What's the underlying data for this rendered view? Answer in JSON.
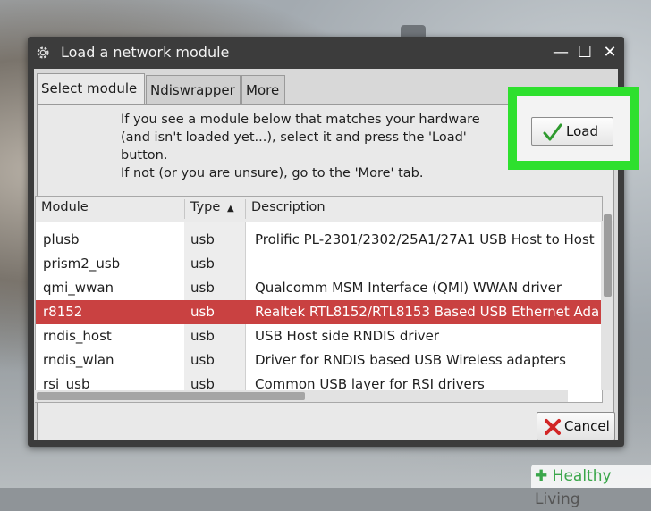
{
  "window": {
    "title": "Load a network module",
    "controls": {
      "minimize": "—",
      "maximize": "☐",
      "close": "✕"
    }
  },
  "tabs": [
    {
      "label": "Select module",
      "active": true
    },
    {
      "label": "Ndiswrapper",
      "active": false
    },
    {
      "label": "More",
      "active": false
    }
  ],
  "info": {
    "line1": "If you see a module below that matches your hardware",
    "line2": "(and isn't loaded yet...), select it and press the 'Load'",
    "line3": "button.",
    "line4": "If not (or you are unsure), go to the 'More' tab."
  },
  "load_button": {
    "label": "Load",
    "icon": "checkmark-icon"
  },
  "table": {
    "columns": {
      "module": "Module",
      "type": "Type",
      "type_sort": "▲",
      "description": "Description"
    },
    "rows": [
      {
        "module": "plusb",
        "type": "usb",
        "description": "Prolific PL-2301/2302/25A1/27A1 USB Host to Host",
        "selected": false
      },
      {
        "module": "prism2_usb",
        "type": "usb",
        "description": "",
        "selected": false
      },
      {
        "module": "qmi_wwan",
        "type": "usb",
        "description": "Qualcomm MSM Interface (QMI) WWAN driver",
        "selected": false
      },
      {
        "module": "r8152",
        "type": "usb",
        "description": "Realtek RTL8152/RTL8153 Based USB Ethernet Ada",
        "selected": true
      },
      {
        "module": "rndis_host",
        "type": "usb",
        "description": "USB Host side RNDIS driver",
        "selected": false
      },
      {
        "module": "rndis_wlan",
        "type": "usb",
        "description": "Driver for RNDIS based USB Wireless adapters",
        "selected": false
      },
      {
        "module": "rsi_usb",
        "type": "usb",
        "description": "Common USB layer for RSI drivers",
        "selected": false
      }
    ]
  },
  "cancel_button": {
    "label": "Cancel",
    "icon": "red-x-icon"
  },
  "watermark": {
    "brand": "Healthy",
    "text": "Living"
  },
  "colors": {
    "highlight": "#2ee02e",
    "selection": "#c94141"
  }
}
